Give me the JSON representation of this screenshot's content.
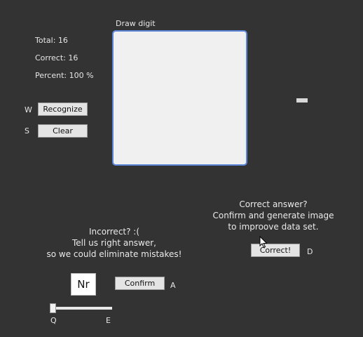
{
  "stats": {
    "total": "Total: 16",
    "correct": "Correct: 16",
    "percent": "Percent: 100 %"
  },
  "canvas": {
    "label": "Draw digit"
  },
  "controls": {
    "recognize_key": "W",
    "recognize_label": "Recognize",
    "clear_key": "S",
    "clear_label": "Clear"
  },
  "prediction": {
    "value": "—"
  },
  "correct_panel": {
    "line1": "Correct answer?",
    "line2": "Confirm and generate image",
    "line3": "to improove data set.",
    "button_label": "Correct!",
    "button_key": "D"
  },
  "incorrect_panel": {
    "line1": "Incorrect? :(",
    "line2": "Tell us right answer,",
    "line3": "so we could eliminate mistakes!",
    "number_box": "Nr",
    "confirm_label": "Confirm",
    "confirm_key": "A",
    "slider_left_key": "Q",
    "slider_right_key": "E",
    "slider_value": 0
  }
}
